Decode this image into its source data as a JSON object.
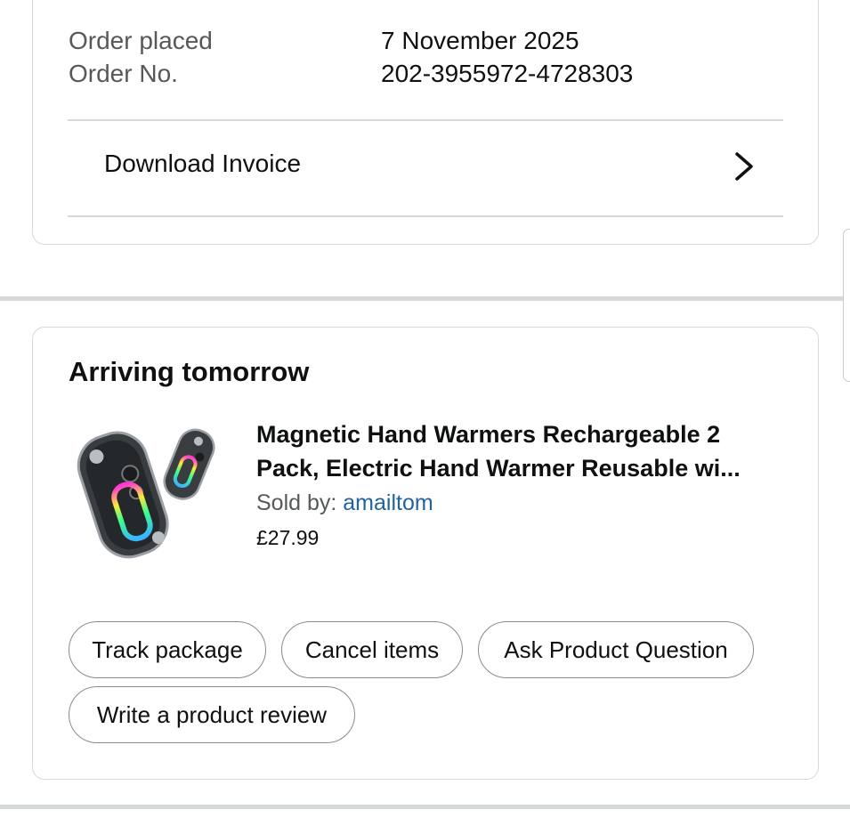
{
  "order": {
    "placed_label": "Order placed",
    "placed_value": "7 November 2025",
    "number_label": "Order No.",
    "number_value": "202-3955972-4728303",
    "download_label": "Download Invoice"
  },
  "shipment": {
    "status_title": "Arriving tomorrow",
    "product": {
      "title_line1": "Magnetic Hand Warmers Rechargeable 2",
      "title_line2": "Pack, Electric Hand Warmer Reusable wi...",
      "sold_by_label": "Sold by: ",
      "seller": "amailtom",
      "price": "£27.99",
      "image_icon": "hand-warmer-product-image"
    },
    "actions": {
      "track": "Track package",
      "cancel": "Cancel items",
      "ask": "Ask Product Question",
      "review": "Write a product review"
    }
  },
  "colors": {
    "link": "#2162a1",
    "border": "#d5d9d9",
    "muted_text": "#565959"
  }
}
